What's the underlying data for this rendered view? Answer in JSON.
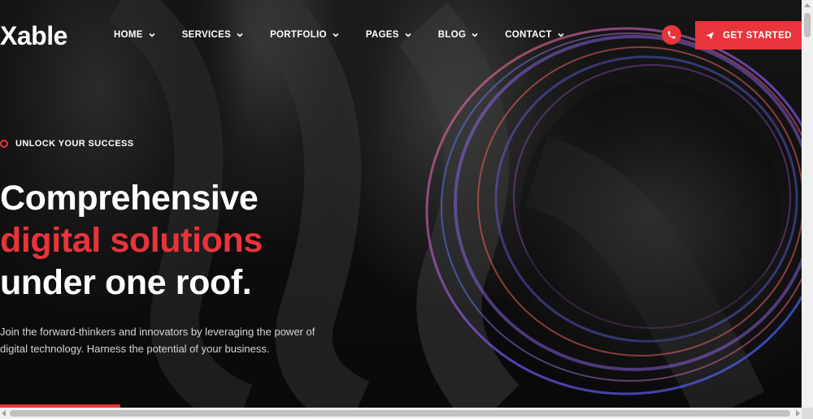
{
  "brand": {
    "logo_text": "able",
    "logo_x": "X"
  },
  "nav": {
    "items": [
      {
        "label": "HOME"
      },
      {
        "label": "SERVICES"
      },
      {
        "label": "PORTFOLIO"
      },
      {
        "label": "PAGES"
      },
      {
        "label": "BLOG"
      },
      {
        "label": "CONTACT"
      }
    ]
  },
  "header": {
    "phone_icon": "phone-icon",
    "cta_label": "GET STARTED",
    "cta_icon": "send-icon"
  },
  "hero": {
    "eyebrow": "UNLOCK YOUR SUCCESS",
    "headline_line1": "Comprehensive",
    "headline_line2": "digital solutions",
    "headline_line3": "under one roof.",
    "lead": "Join the forward-thinkers and innovators by leveraging the power of digital technology. Harness the potential of your business."
  },
  "colors": {
    "accent": "#e8343a",
    "background": "#0a0a0a",
    "text": "#ffffff",
    "muted": "#d6d6d6"
  }
}
